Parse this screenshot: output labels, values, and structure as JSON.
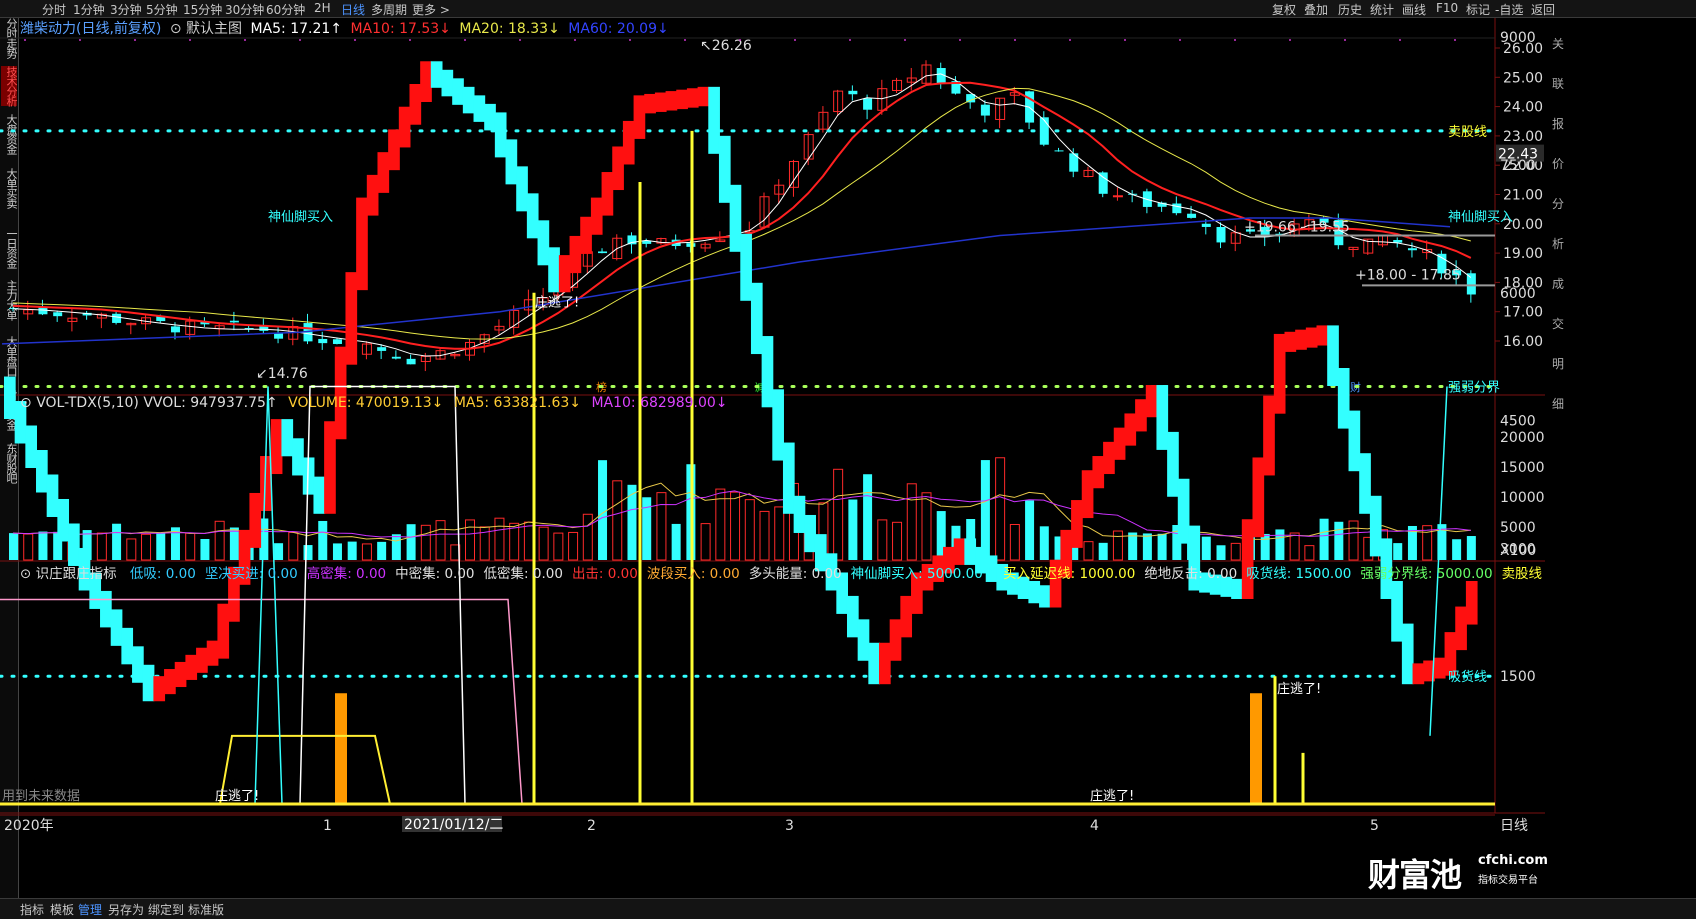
{
  "topbar": {
    "left_tabs": [
      "分时",
      "1分钟",
      "3分钟",
      "5分钟",
      "15分钟",
      "30分钟",
      "60分钟",
      "2H",
      "日线",
      "多周期",
      "更多 >"
    ],
    "active_tab": "日线",
    "right_tabs": [
      "复权",
      "叠加",
      "历史",
      "统计",
      "画线",
      "F10",
      "标记",
      "-自选",
      "返回"
    ]
  },
  "sidebar": {
    "items": [
      "分时走势",
      "技术分析",
      "大盘资金",
      "大单买卖",
      "一日资金",
      "主力大单",
      "大单盘口",
      "财富资金",
      "东财股吧"
    ],
    "active": "技术分析"
  },
  "main_header": {
    "stock": "潍柴动力(日线,前复权)",
    "template": "默认主图",
    "ma5": "MA5: 17.21↑",
    "ma10": "MA10: 17.53↓",
    "ma20": "MA20: 18.33↓",
    "ma60": "MA60: 20.09↓"
  },
  "main_annotations": {
    "high": "26.26",
    "low": "14.76",
    "range1": "19.66 - 19.55",
    "range2": "18.00 - 17.85",
    "current_price": "22.43",
    "marker_bang": "榜",
    "marker_jian": "减",
    "marker_cai": "财"
  },
  "vol_header": {
    "title": "VOL-TDX(5,10)",
    "vvol": "VVOL: 947937.75↑",
    "volume": "VOLUME: 470019.13↓",
    "ma5": "MA5: 633821.63↓",
    "ma10": "MA10: 682989.00↓"
  },
  "ind_header": {
    "title": "识庄跟庄指标",
    "items": [
      {
        "text": "低吸: 0.00",
        "color": "#33ccff"
      },
      {
        "text": "坚决买进: 0.00",
        "color": "#33ccff"
      },
      {
        "text": "高密集: 0.00",
        "color": "#cc33ff"
      },
      {
        "text": "中密集: 0.00",
        "color": "#e0e0e0"
      },
      {
        "text": "低密集: 0.00",
        "color": "#e0e0e0"
      },
      {
        "text": "出击: 0.00",
        "color": "#ff3333"
      },
      {
        "text": "波段买入: 0.00",
        "color": "#ffaa33"
      },
      {
        "text": "多头能量: 0.00",
        "color": "#e0e0e0"
      },
      {
        "text": "神仙脚买入: 5000.00↑",
        "color": "#33ffff"
      },
      {
        "text": "买入延迟线: 1000.00",
        "color": "#ffff33"
      },
      {
        "text": "绝地反击: 0.00",
        "color": "#e0e0e0"
      },
      {
        "text": "吸货线: 1500.00",
        "color": "#33ffff"
      },
      {
        "text": "强弱分界线: 5000.00",
        "color": "#66ff66"
      },
      {
        "text": "卖股线",
        "color": "#ffff33"
      }
    ],
    "labels": {
      "sell_line": "卖股线",
      "god_foot": "神仙脚买入",
      "strong_weak": "强弱分界",
      "absorb": "吸货线",
      "escape1": "庄逃了!",
      "escape2": "庄逃了!",
      "escape3": "庄逃了!",
      "escape4": "庄逃了!",
      "escape5": "庄逃了!",
      "future_data": "用到未来数据"
    }
  },
  "main_axis": [
    "26.00",
    "25.00",
    "24.00",
    "23.00",
    "22.00",
    "21.00",
    "20.00",
    "19.00",
    "18.00",
    "17.00",
    "16.00"
  ],
  "vol_axis": [
    "20000",
    "15000",
    "10000",
    "5000",
    "X100"
  ],
  "ind_axis": [
    "9000",
    "7500",
    "6000",
    "4500",
    "3000",
    "1500"
  ],
  "date_axis": {
    "year": "2020年",
    "m1": "1",
    "cursor": "2021/01/12/二",
    "m2": "2",
    "m3": "3",
    "m4": "4",
    "m5": "5",
    "period": "日线"
  },
  "bottombar": {
    "items": [
      "指标",
      "模板",
      "管理",
      "另存为",
      "绑定到",
      "标准版"
    ],
    "active": "管理"
  },
  "right_edge": [
    "关",
    "联",
    "报",
    "价",
    "分",
    "析",
    "成",
    "交",
    "明",
    "细"
  ],
  "watermark": {
    "cn": "财富池",
    "en": "cfchi.com",
    "sub": "指标交易平台"
  },
  "colors": {
    "up": "#ff2a2a",
    "down": "#33ffff",
    "ma5": "#ffffff",
    "ma10": "#ff2020",
    "ma20": "#e8e84a",
    "ma60": "#2233cc"
  }
}
